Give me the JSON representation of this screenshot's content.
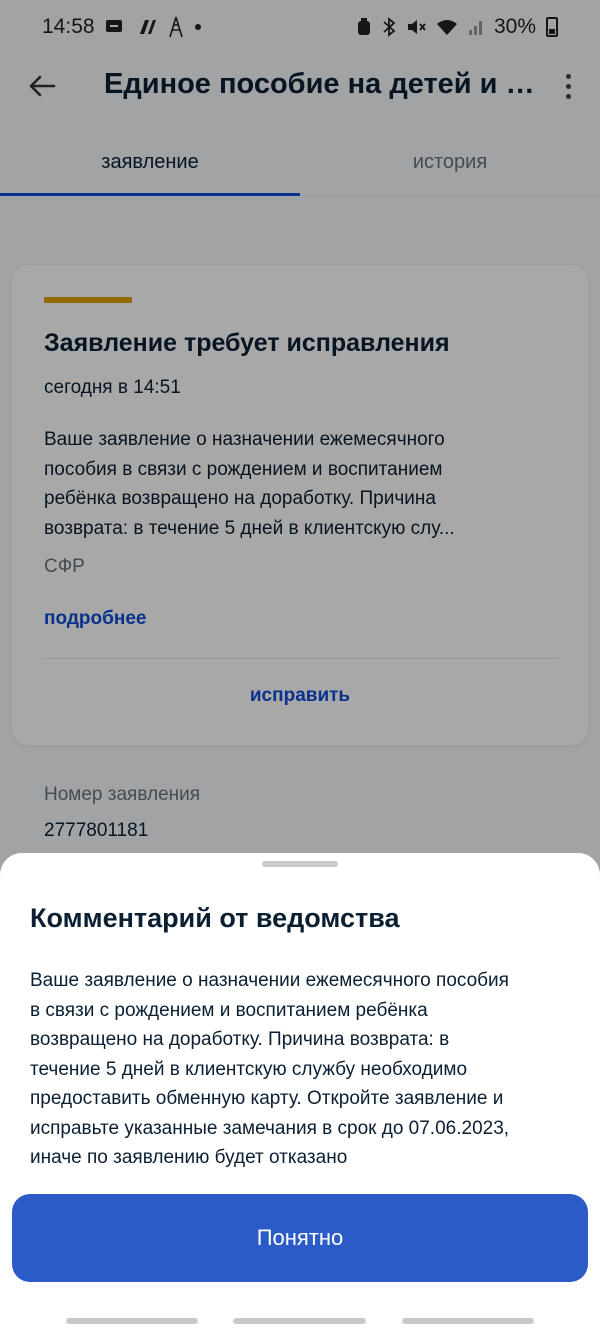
{
  "status_bar": {
    "time": "14:58",
    "battery": "30%",
    "icons": [
      "message-icon",
      "nfc-icon",
      "tower-icon",
      "dot-icon",
      "alarm-icon",
      "bluetooth-icon",
      "mute-icon",
      "wifi-icon",
      "signal-icon",
      "battery-icon"
    ]
  },
  "appbar": {
    "title": "Единое пособие на детей и бере"
  },
  "tabs": [
    {
      "label": "заявление",
      "active": true
    },
    {
      "label": "история",
      "active": false
    }
  ],
  "card": {
    "accent_color": "#e2a300",
    "title": "Заявление требует исправления",
    "time": "сегодня в 14:51",
    "text_lines": [
      "Ваше заявление о назначении ежемесячного",
      "пособия в связи с рождением и воспитанием",
      "ребёнка возвращено на доработку. Причина",
      "возврата: в течение 5 дней в клиентскую слу..."
    ],
    "org": "СФР",
    "more_link": "подробнее",
    "fix_button": "исправить"
  },
  "application": {
    "label": "Номер заявления",
    "number": "2777801181"
  },
  "sheet": {
    "title": "Комментарий от ведомства",
    "text_lines": [
      "Ваше заявление о назначении ежемесячного пособия",
      "в связи с рождением и воспитанием ребёнка",
      "возвращено на доработку. Причина возврата: в",
      "течение 5 дней в клиентскую службу необходимо",
      "предоставить обменную карту. Откройте заявление и",
      "исправьте указанные замечания в срок до 07.06.2023,",
      "иначе по заявлению будет отказано"
    ],
    "ok_button": "Понятно"
  },
  "colors": {
    "primary": "#0d4cd3",
    "button": "#2b5bc7",
    "warning_accent": "#e2a300"
  }
}
